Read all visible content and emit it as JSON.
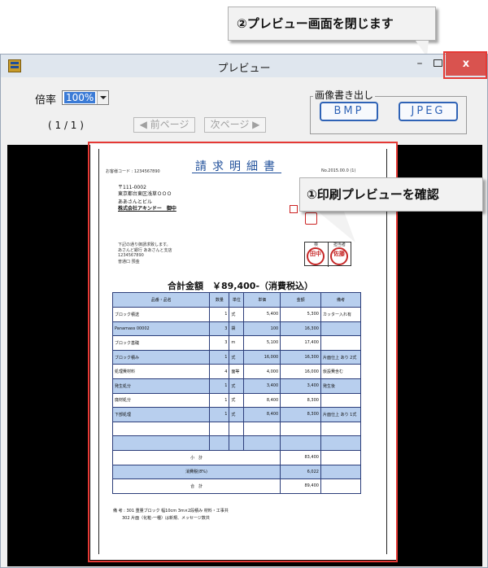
{
  "window": {
    "title": "プレビュー",
    "minimize_label": "–",
    "close_label": "x"
  },
  "controls": {
    "zoom_label": "倍率",
    "zoom_value": "100%",
    "page_counter": "( 1 / 1 )",
    "prev_page_label": "◀ 前ページ",
    "next_page_label": "次ページ ▶",
    "image_output_label": "画像書き出し",
    "bmp_label": "BMP",
    "jpeg_label": "JPEG"
  },
  "annotations": {
    "close_callout": "②プレビュー画面を閉じます",
    "preview_callout": "①印刷プレビューを確認"
  },
  "document": {
    "title": "請求明細書",
    "ref_line": "お客様コード : 1234567890",
    "date_line": "No.2015.00.0 (1)",
    "customer_postal": "〒111-0002",
    "customer_address": "東京都台東区浅草ＯＯＯ",
    "customer_building": "ああさんとビル",
    "customer_name": "株式会社アキンドー　御中",
    "sender_lines": [
      "下記の通り御請求致します。",
      "あさんど銀行 ああさんと支店",
      "1234567890",
      "普通口 預金"
    ],
    "stamp_labels": [
      "検",
      "担当者"
    ],
    "stamp_texts": [
      "田中",
      "佐藤"
    ],
    "total_text": "合計金額　￥89,400-（消費税込）",
    "table": {
      "headers": [
        "品番・品名",
        "数量",
        "単位",
        "単価",
        "金額",
        "備考"
      ],
      "rows": [
        [
          "ブロック積送",
          "1",
          "式",
          "5,400",
          "5,300",
          "カッター入れ有"
        ],
        [
          "Panamass 00002 ",
          "3",
          "袋",
          "100",
          "16,300",
          ""
        ],
        [
          "ブロック基礎",
          "3",
          "m",
          "5,100",
          "17,400",
          ""
        ],
        [
          "ブロック積み",
          "1",
          "式",
          "16,000",
          "16,300",
          "片面仕上 あり 2式"
        ],
        [
          "処理費材料",
          "4",
          "面等",
          "4,000",
          "16,000",
          "仮設費含む"
        ],
        [
          "発生処分",
          "1",
          "式",
          "3,400",
          "3,400",
          "発生後"
        ],
        [
          "廃材処分",
          "1",
          "式",
          "8,400",
          "8,300",
          ""
        ],
        [
          "下部処理",
          "1",
          "式",
          "8,400",
          "8,300",
          "片面仕上 あり 1式"
        ],
        [
          "",
          "",
          "",
          "",
          "",
          ""
        ],
        [
          "",
          "",
          "",
          "",
          "",
          ""
        ]
      ],
      "subtotal_label": "小　計",
      "subtotal_value": "83,400",
      "tax_label": "消費税(8%)",
      "tax_value": "6,022",
      "total_label": "合　計",
      "total_value": "89,400"
    },
    "footnote1": "備 考 : 301 重量ブロック 幅10cm 3m×2段積み 材料・工事共",
    "footnote2": "302 片面（化粧-一種）は新規、メッセージ数共"
  }
}
